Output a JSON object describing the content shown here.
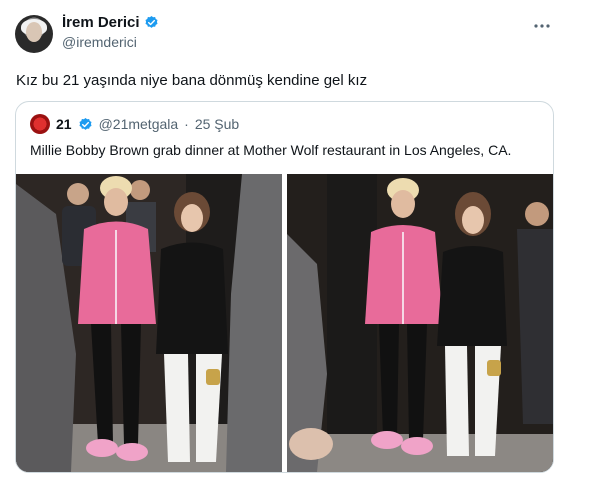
{
  "author": {
    "display_name": "İrem Derici",
    "handle": "@iremderici",
    "verified_icon": "verified-badge-icon",
    "verified_color": "#1d9bf0"
  },
  "menu_icon": "more-horizontal-icon",
  "tweet": {
    "text": "Kız bu 21 yaşında niye bana dönmüş kendine gel kız"
  },
  "quoted": {
    "name": "21",
    "verified_icon": "verified-badge-icon",
    "handle": "@21metgala",
    "separator": "·",
    "date": "25 Şub",
    "text": "Millie Bobby Brown grab dinner at Mother Wolf restaurant in Los Angeles, CA."
  },
  "colors": {
    "text": "#0f1419",
    "muted": "#536471",
    "border": "#cfd9de",
    "pink_jacket": "#e86b9a",
    "accent": "#1d9bf0"
  }
}
